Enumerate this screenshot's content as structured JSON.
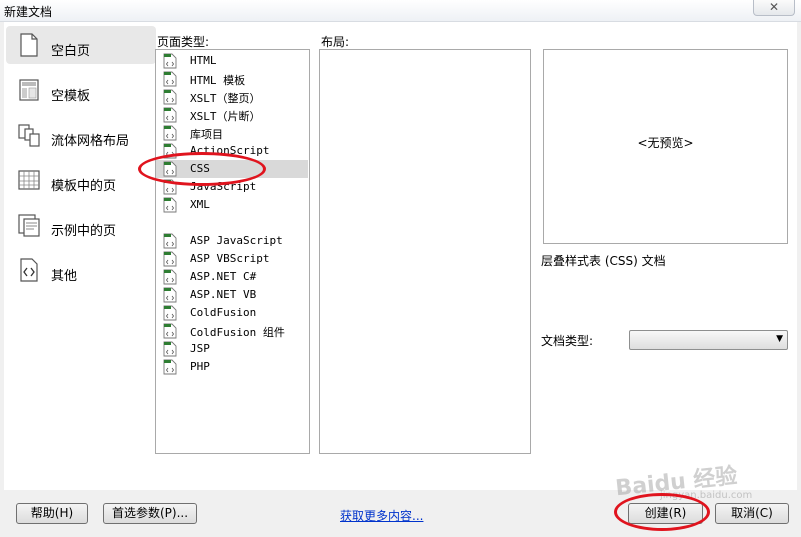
{
  "window": {
    "title": "新建文档",
    "close_glyph": "✕"
  },
  "categories": [
    {
      "label": "空白页",
      "icon": "blank-page-icon",
      "selected": true
    },
    {
      "label": "空模板",
      "icon": "blank-template-icon",
      "selected": false
    },
    {
      "label": "流体网格布局",
      "icon": "fluid-grid-icon",
      "selected": false
    },
    {
      "label": "模板中的页",
      "icon": "template-page-icon",
      "selected": false
    },
    {
      "label": "示例中的页",
      "icon": "sample-page-icon",
      "selected": false
    },
    {
      "label": "其他",
      "icon": "other-code-icon",
      "selected": false
    }
  ],
  "page_types": {
    "label": "页面类型:",
    "items": [
      {
        "label": "HTML",
        "selected": false
      },
      {
        "label": "HTML 模板",
        "selected": false
      },
      {
        "label": "XSLT（整页）",
        "selected": false
      },
      {
        "label": "XSLT（片断）",
        "selected": false
      },
      {
        "label": "库项目",
        "selected": false
      },
      {
        "label": "ActionScript",
        "selected": false
      },
      {
        "label": "CSS",
        "selected": true
      },
      {
        "label": "JavaScript",
        "selected": false
      },
      {
        "label": "XML",
        "selected": false
      },
      {
        "label": "ASP JavaScript",
        "selected": false
      },
      {
        "label": "ASP VBScript",
        "selected": false
      },
      {
        "label": "ASP.NET C#",
        "selected": false
      },
      {
        "label": "ASP.NET VB",
        "selected": false
      },
      {
        "label": "ColdFusion",
        "selected": false
      },
      {
        "label": "ColdFusion 组件",
        "selected": false
      },
      {
        "label": "JSP",
        "selected": false
      },
      {
        "label": "PHP",
        "selected": false
      }
    ]
  },
  "layout": {
    "label": "布局:"
  },
  "preview": {
    "text": "<无预览>"
  },
  "description": "层叠样式表 (CSS) 文档",
  "doctype": {
    "label": "文档类型:",
    "value": ""
  },
  "buttons": {
    "help": "帮助(H)",
    "preferences": "首选参数(P)...",
    "more_content": "获取更多内容...",
    "create": "创建(R)",
    "cancel": "取消(C)"
  },
  "watermark": {
    "brand": "Baidu 经验",
    "url": "jingyan.baidu.com"
  },
  "colors": {
    "annotation_circle": "#e0141e",
    "link": "#0033cc",
    "selection": "#d9d9d9"
  }
}
